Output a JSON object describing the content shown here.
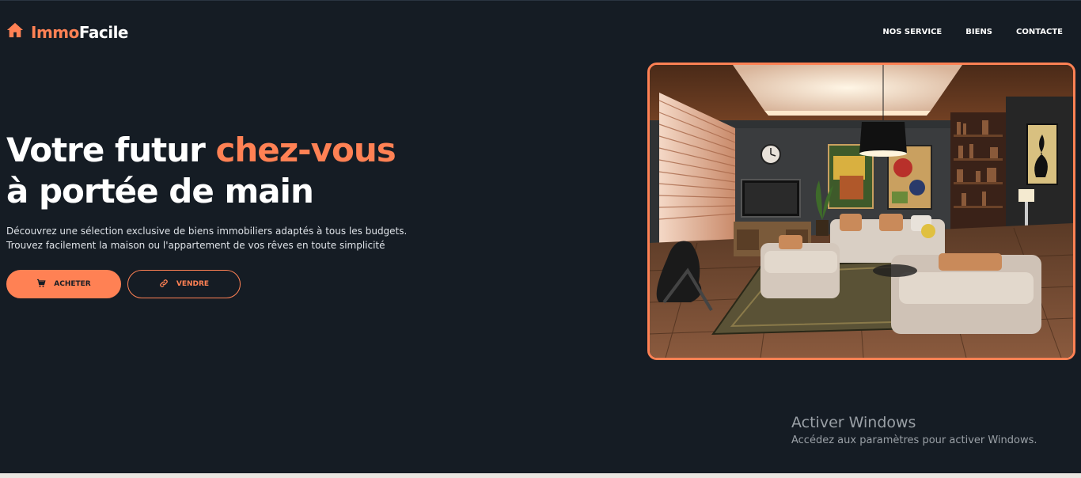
{
  "logo": {
    "accent": "Immo",
    "main": "Facile",
    "icon": "home-icon"
  },
  "nav": {
    "items": [
      "NOS SERVICE",
      "BIENS",
      "CONTACTE"
    ]
  },
  "hero": {
    "title_line1_prefix": "Votre futur ",
    "title_line1_accent": "chez-vous",
    "title_line2": "à portée de main",
    "description_line1": "Découvrez une sélection exclusive de biens immobiliers adaptés à tous les budgets.",
    "description_line2": "Trouvez facilement la maison ou l'appartement de vos rêves en toute simplicité",
    "buy_button": {
      "label": "ACHETER",
      "icon": "cart-icon"
    },
    "sell_button": {
      "label": "VENDRE",
      "icon": "link-icon"
    },
    "image": "living-room-photo"
  },
  "windows_watermark": {
    "title": "Activer Windows",
    "subtitle": "Accédez aux paramètres pour activer Windows."
  },
  "colors": {
    "background": "#151c24",
    "accent": "#ff8154",
    "text": "#ffffff"
  }
}
